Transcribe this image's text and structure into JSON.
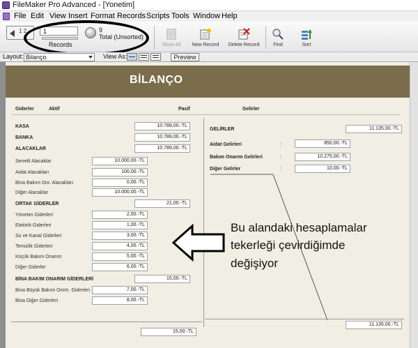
{
  "window": {
    "title": "FileMaker Pro Advanced - [Yonetim]"
  },
  "menu": [
    "File",
    "Edit",
    "View",
    "Insert",
    "Format",
    "Records",
    "Scripts",
    "Tools",
    "Window",
    "Help"
  ],
  "toolbar": {
    "book_page": "1 2",
    "record_field": "1",
    "records_label": "Records",
    "total_count": "9",
    "total_label": "Total (Unsorted)",
    "show_all": "Show All",
    "new_record": "New Record",
    "delete_record": "Delete Record",
    "find": "Find",
    "sort": "Sort"
  },
  "layout_bar": {
    "layout_label": "Layout:",
    "layout_value": "Bilanço",
    "view_as_label": "View As:",
    "preview": "Preview"
  },
  "report": {
    "title": "BİLANÇO",
    "col_giderler": "Giderler",
    "col_aktif": "Aktif",
    "col_pasif": "Pasif",
    "col_gelirler": "Gelirler",
    "left": {
      "kasa": {
        "label": "KASA",
        "value": "10.789,00.-TL"
      },
      "banka": {
        "label": "BANKA",
        "value": "10.789,00.-TL"
      },
      "alacaklar": {
        "label": "ALACAKLAR",
        "value": "10.789,00.-TL"
      },
      "alacak_items": [
        {
          "label": "Senetli Alacaklar",
          "value": "10.000,00.-TL"
        },
        {
          "label": "Aidat Alacakları",
          "value": "100,00.-TL"
        },
        {
          "label": "Bina Bakım Onr. Alacakları",
          "value": "0,00.-TL"
        },
        {
          "label": "Diğer Alacaklar",
          "value": "10.000,00.-TL"
        }
      ],
      "ortak": {
        "label": "ORTAK GİDERLER",
        "value": "21,00.-TL"
      },
      "ortak_items": [
        {
          "label": "Yönetim Giderleri",
          "value": "2,00.-TL"
        },
        {
          "label": "Elektrik Giderleri",
          "value": "1,00.-TL"
        },
        {
          "label": "Su ve Kanal Giderleri",
          "value": "3,00.-TL"
        },
        {
          "label": "Temizlik Giderleri",
          "value": "4,00.-TL"
        },
        {
          "label": "Küçük Bakım Onarım",
          "value": "5,00.-TL"
        },
        {
          "label": "Diğer Giderler",
          "value": "6,00.-TL"
        }
      ],
      "bina": {
        "label": "BİNA BAKIM ONARIM GİDERLERİ",
        "value": "15,00.-TL"
      },
      "bina_items": [
        {
          "label": "Bina Büyük Bakım Onrm. Giderleri",
          "value": "7,00.-TL"
        },
        {
          "label": "Bina Diğer Giderleri",
          "value": "8,00.-TL"
        }
      ],
      "bottom_total": "15,00.-TL"
    },
    "right": {
      "gelirler": {
        "label": "GELİRLER",
        "value": "11.135,00.-TL"
      },
      "items": [
        {
          "label": "Aidat Gelirleri",
          "colon": ":",
          "value": "850,00.-TL"
        },
        {
          "label": "Bakım Onarım Gelirleri",
          "colon": ":",
          "value": "10.275,00.-TL"
        },
        {
          "label": "Diğer Gelirler",
          "colon": ":",
          "value": "10,00.-TL"
        }
      ],
      "bottom_total": "11.135,00.-TL"
    }
  },
  "annotation": {
    "line1": "Bu alandaki hesaplamalar",
    "line2": "tekerleği çevirdiğimde",
    "line3": "değişiyor"
  },
  "colors": {
    "header_band": "#7b6d4c",
    "content_bg": "#f1eee4"
  }
}
